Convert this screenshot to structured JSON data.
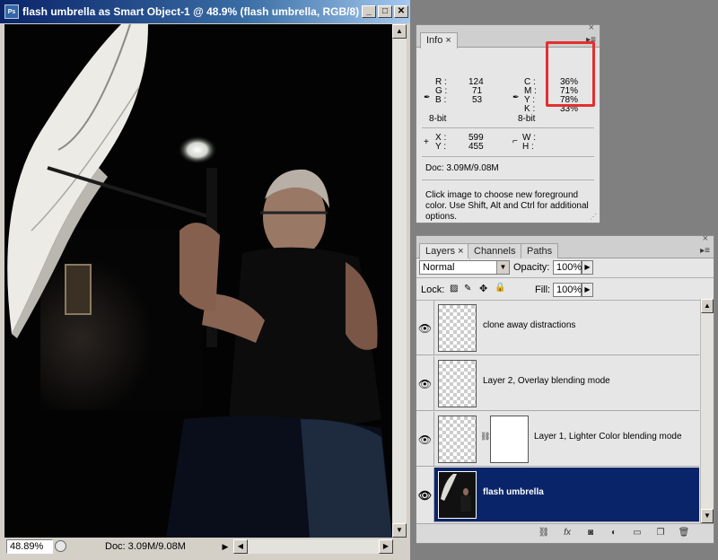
{
  "document": {
    "title": "flash umbrella as Smart Object-1 @ 48.9% (flash umbrella, RGB/8)",
    "app_icon_text": "Ps",
    "window_buttons": {
      "minimize": "_",
      "maximize": "□",
      "close": "✕"
    },
    "zoom": "48.89%",
    "doc_size": "Doc: 3.09M/9.08M",
    "nav_arrow": "▶"
  },
  "info_panel": {
    "tab": "Info",
    "rgb": [
      {
        "label": "R :",
        "value": "124"
      },
      {
        "label": "G :",
        "value": "71"
      },
      {
        "label": "B :",
        "value": "53"
      }
    ],
    "cmyk": [
      {
        "label": "C :",
        "value": "36%"
      },
      {
        "label": "M :",
        "value": "71%"
      },
      {
        "label": "Y :",
        "value": "78%"
      },
      {
        "label": "K :",
        "value": "33%"
      }
    ],
    "bit_left": "8-bit",
    "bit_right": "8-bit",
    "pos": [
      {
        "label": "X :",
        "value": "599"
      },
      {
        "label": "Y :",
        "value": "455"
      }
    ],
    "size": [
      {
        "label": "W :",
        "value": ""
      },
      {
        "label": "H :",
        "value": ""
      }
    ],
    "doc": "Doc: 3.09M/9.08M",
    "hint": "Click image to choose new foreground color.  Use Shift, Alt and Ctrl for additional options."
  },
  "layers_panel": {
    "tabs": [
      "Layers",
      "Channels",
      "Paths"
    ],
    "blend_mode": "Normal",
    "opacity_label": "Opacity:",
    "opacity": "100%",
    "lock_label": "Lock:",
    "fill_label": "Fill:",
    "fill": "100%",
    "layers": [
      {
        "name": "clone away distractions",
        "selected": false
      },
      {
        "name": "Layer 2, Overlay blending mode",
        "selected": false
      },
      {
        "name": "Layer 1, Lighter Color blending mode",
        "selected": false
      },
      {
        "name": "flash umbrella",
        "selected": true
      }
    ],
    "footer_icons": [
      "link-icon",
      "fx-icon",
      "mask-icon",
      "adjustment-icon",
      "group-icon",
      "new-layer-icon",
      "trash-icon"
    ]
  },
  "colors": {
    "selection": "#0a2469",
    "highlight": "#e32f2f",
    "titlebar": "#0a246a"
  }
}
